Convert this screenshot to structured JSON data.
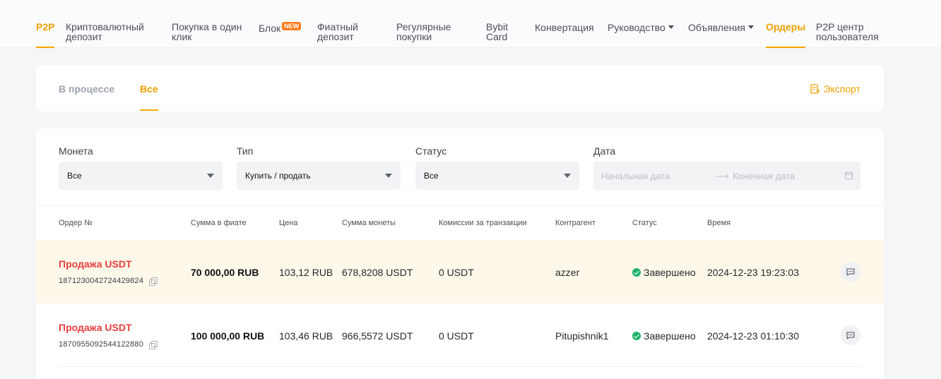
{
  "nav": {
    "p2p": "P2P",
    "crypto_deposit": [
      "Криптовалютный",
      "депозит"
    ],
    "one_click": [
      "Покупка в один",
      "клик"
    ],
    "block": "Блок",
    "block_badge": "NEW",
    "fiat_deposit": [
      "Фиатный",
      "депозит"
    ],
    "regular": [
      "Регулярные",
      "покупки"
    ],
    "bybit_card": [
      "Bybit",
      "Card"
    ],
    "conversion": "Конвертация",
    "guide": "Руководство",
    "ads": "Объявления",
    "orders": "Ордеры",
    "user_center": [
      "P2P центр",
      "пользователя"
    ]
  },
  "tabs": {
    "in_progress": "В процессе",
    "all": "Все",
    "export": "Экспорт"
  },
  "filters": {
    "coin_label": "Монета",
    "coin_value": "Все",
    "type_label": "Тип",
    "type_value": "Купить / продать",
    "status_label": "Статус",
    "status_value": "Все",
    "date_label": "Дата",
    "start_placeholder": "Начальная дата",
    "end_placeholder": "Конечная дата"
  },
  "table": {
    "headers": [
      "Ордер №",
      "Сумма в фиате",
      "Цена",
      "Сумма монеты",
      "Комиссии за транзакции",
      "Контрагент",
      "Статус",
      "Время"
    ],
    "rows": [
      {
        "type": "Продажа USDT",
        "id": "1871230042724429824",
        "fiat": "70 000,00 RUB",
        "price": "103,12 RUB",
        "coin": "678,8208 USDT",
        "fee": "0 USDT",
        "counterparty": "azzer",
        "status": "Завершено",
        "time": "2024-12-23 19:23:03"
      },
      {
        "type": "Продажа USDT",
        "id": "1870955092544122880",
        "fiat": "100 000,00 RUB",
        "price": "103,46 RUB",
        "coin": "966,5572 USDT",
        "fee": "0 USDT",
        "counterparty": "Pitupishnik1",
        "status": "Завершено",
        "time": "2024-12-23 01:10:30"
      }
    ]
  },
  "colors": {
    "accent": "#f7a600",
    "sell": "#e53e3e",
    "success": "#20b26c",
    "highlight_row": "#fef8ea"
  }
}
